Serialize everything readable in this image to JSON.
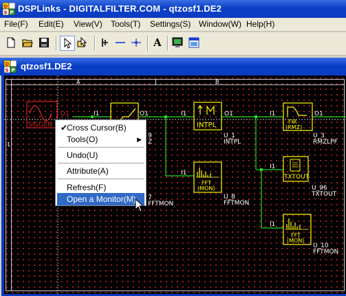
{
  "app": {
    "title": "DSPLinks - DIGITALFILTER.COM - qtzosf1.DE2"
  },
  "menu": [
    "File(F)",
    "Edit(E)",
    "View(V)",
    "Tools(T)",
    "Settings(S)",
    "Window(W)",
    "Help(H)"
  ],
  "toolbar": {
    "buttons": [
      "new-file-icon",
      "open-folder-icon",
      "save-disk-icon",
      "pointer-icon",
      "wire-pointer-icon",
      "probe-icon",
      "hline-icon",
      "cross-point-icon",
      "text-icon",
      "monitor-icon",
      "window-icon"
    ],
    "text_label": "A"
  },
  "document": {
    "title": "qtzosf1.DE2",
    "column_labels": [
      "A",
      "B"
    ],
    "row_labels": [
      "1"
    ],
    "blocks": [
      {
        "name": "SIGGEN",
        "port_label": "O1",
        "id": "",
        "type": ""
      },
      {
        "name": "",
        "port_label": "O1",
        "in_label": "I1",
        "id": "9",
        "type": "Z"
      },
      {
        "name": "INTPL",
        "in_label": "I1",
        "port_label": "O1",
        "id": "U_1",
        "type": "INTPL"
      },
      {
        "name": "FIR\n(RMZ)",
        "in_label": "I1",
        "port_label": "O1",
        "id": "U_3",
        "type": "RMZLPF"
      },
      {
        "name": "FFT\n(MON)",
        "in_label": "I1",
        "id": "U_8",
        "type": "FFTMON"
      },
      {
        "name": "TXTOUT",
        "in_label": "I1",
        "id": "U_96",
        "type": "TXTOUT"
      },
      {
        "name": "FFT\n(MON)",
        "in_label": "I1",
        "id": "U_10",
        "type": "FFTMON"
      },
      {
        "name": "",
        "id": "7",
        "type": "FFTMON"
      }
    ]
  },
  "context_menu": {
    "items": [
      {
        "label": "Cross Cursor(B)",
        "checked": true
      },
      {
        "label": "Tools(O)",
        "submenu": true
      },
      {
        "label": "Undo(U)"
      },
      {
        "label": "Attribute(A)"
      },
      {
        "label": "Refresh(F)"
      },
      {
        "label": "Open a Monitor(M)",
        "highlighted": true
      }
    ],
    "check_glyph": "✔",
    "arrow_glyph": "▶"
  },
  "colors": {
    "grid_dot": "#b22222",
    "wire": "#22dd22",
    "block": "#ffff00",
    "label": "#ffffff",
    "accent_title": "#0a3fc8",
    "highlight": "#316ac5"
  }
}
